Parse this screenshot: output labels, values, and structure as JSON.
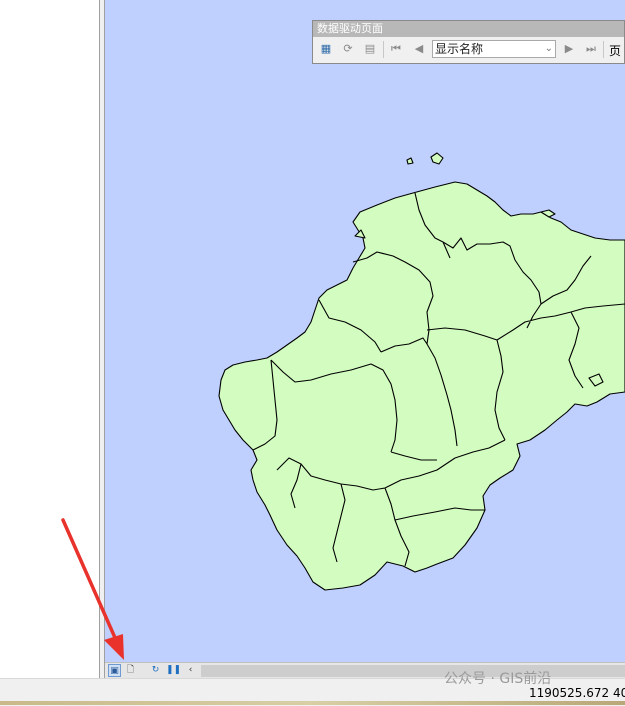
{
  "app": {
    "watermark": "公众号 · GIS前沿"
  },
  "data_driven_pages_toolbar": {
    "title": "数据驱动页面",
    "page_field": "显示名称",
    "page_label": "页",
    "icons": [
      "setup-icon",
      "refresh-icon",
      "table-icon",
      "first-page-icon",
      "previous-page-icon",
      "next-page-icon",
      "last-page-icon"
    ]
  },
  "status_bar": {
    "coordinates": "1190525.672  40"
  },
  "view_bar": {
    "icons": [
      "data-view-icon",
      "layout-view-icon",
      "refresh-view-icon",
      "pause-drawing-icon",
      "scroll-left-icon"
    ]
  },
  "colors": {
    "water": "#bfd0fe",
    "land": "#d3fcc0",
    "annotation_arrow": "#e8322b"
  }
}
